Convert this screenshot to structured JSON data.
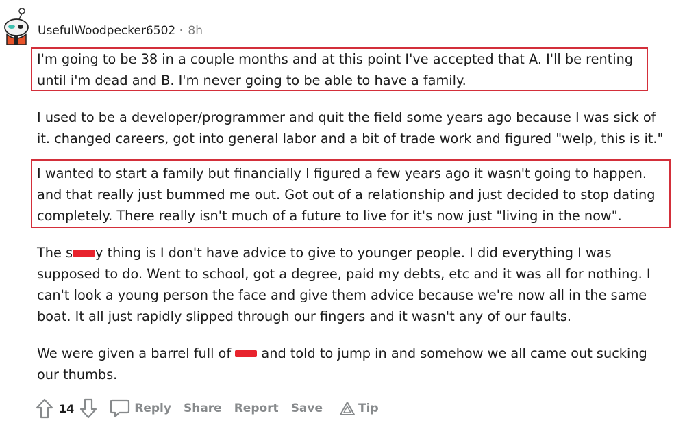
{
  "comment": {
    "author": "UsefulWoodpecker6502",
    "separator": "·",
    "time": "8h",
    "paragraphs": [
      "I'm going to be 38 in a couple months and at this point I've accepted that A. I'll be renting\nuntil i'm dead and B. I'm never going to be able to have a family.",
      "I used to be a developer/programmer and quit the field some years ago because I was sick of\nit. changed careers, got into general labor and a bit of trade work and figured \"welp, this is it.\"",
      "I wanted to start a family but financially I figured a few years ago it wasn't going to happen.\nand that really just bummed me out. Got out of a relationship and just decided to stop dating\ncompletely. There really isn't much of a future to live for it's now just \"living in the now\"."
    ],
    "p4": {
      "before": "The s",
      "after": "y thing is I don't have advice to give to younger people. I did everything I was\nsupposed to do. Went to school, got a degree, paid my debts, etc and it was all for nothing. I\ncan't look a young person the face and give them advice because we're now all in the same\nboat. It all just rapidly slipped through our fingers and it wasn't any of our faults."
    },
    "p5": {
      "before": "We were given a barrel full of ",
      "after": " and told to jump in and somehow we all came out sucking\nour thumbs."
    }
  },
  "actions": {
    "upvote_icon": "arrow-up-icon",
    "downvote_icon": "arrow-down-icon",
    "score": "14",
    "reply": "Reply",
    "share": "Share",
    "report": "Report",
    "save": "Save",
    "tip": "Tip",
    "reply_icon": "speech-bubble-icon",
    "tip_icon": "triangle-award-icon"
  },
  "colors": {
    "highlight_border": "#d32f3a",
    "redaction": "#e8232d",
    "muted_text": "#878a8c"
  }
}
